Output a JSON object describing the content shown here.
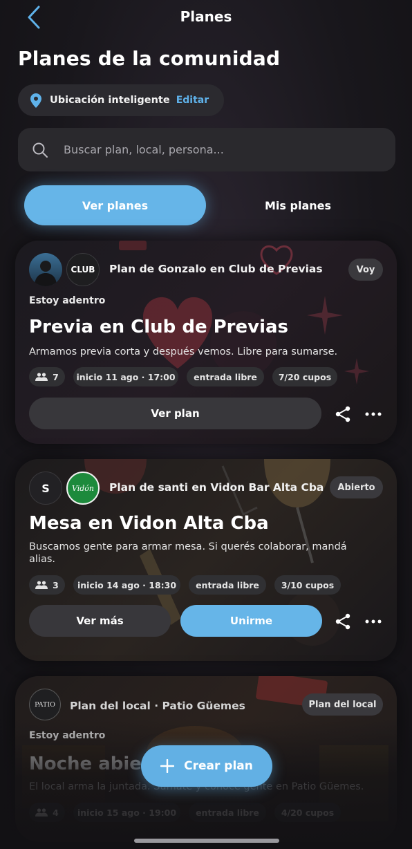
{
  "header": {
    "back_icon": "chevron-left-icon",
    "title": "Planes",
    "page_title": "Planes de la comunidad"
  },
  "location": {
    "icon": "location-pin-icon",
    "label": "Ubicación inteligente",
    "edit_label": "Editar"
  },
  "search": {
    "icon": "search-icon",
    "placeholder": "Buscar plan, local, persona..."
  },
  "segments": {
    "active": "Ver planes",
    "inactive": "Mis planes"
  },
  "plans": [
    {
      "host": "Plan de Gonzalo en Club de Previas",
      "venue_logo_text": "CLUB",
      "tag": "Voy",
      "status": "Estoy adentro",
      "title": "Previa en Club de Previas",
      "description": "Armamos previa corta y después vemos. Libre para sumarse.",
      "people": "7",
      "start": "inicio 11 ago · 17:00",
      "entry": "entrada libre",
      "spots": "7/20 cupos",
      "primary_button": "Ver plan"
    },
    {
      "host": "Plan de santi en Vidon Bar Alta Cba",
      "avatar_initial": "S",
      "venue_logo_text": "Vidón",
      "tag": "Abierto",
      "title": "Mesa en Vidon Alta Cba",
      "description": "Buscamos gente para armar mesa. Si querés colaborar, mandá alias.",
      "people": "3",
      "start": "inicio 14 ago · 18:30",
      "entry": "entrada libre",
      "spots": "3/10 cupos",
      "secondary_button": "Ver más",
      "primary_button": "Unirme"
    },
    {
      "host": "Plan del local · Patio Güemes",
      "venue_logo_text": "PATIO",
      "tag": "Plan del local",
      "status": "Estoy adentro",
      "title": "Noche abierta",
      "description": "El local arma la juntada. Sumate y conocé gente en Patio Güemes.",
      "people": "4",
      "start": "inicio 15 ago · 19:00",
      "entry": "entrada libre",
      "spots": "4/20 cupos"
    }
  ],
  "fab": {
    "icon": "plus-icon",
    "label": "Crear plan"
  },
  "colors": {
    "accent": "#66b5e8",
    "background": "#19171c",
    "card": "#1b1a1f",
    "chip": "#303033"
  }
}
